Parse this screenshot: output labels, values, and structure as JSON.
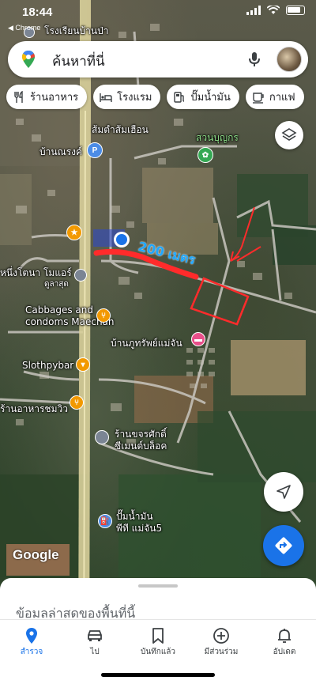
{
  "status_bar": {
    "time": "18:44",
    "back_label": "◀ Chrome"
  },
  "search": {
    "placeholder": "ค้นหาที่นี่"
  },
  "chips": [
    {
      "icon": "fork-knife-icon",
      "label": "ร้านอาหาร"
    },
    {
      "icon": "bed-icon",
      "label": "โรงแรม"
    },
    {
      "icon": "gas-pump-icon",
      "label": "ปั๊มน้ำมัน"
    },
    {
      "icon": "coffee-cup-icon",
      "label": "กาแฟ"
    }
  ],
  "map": {
    "annotation_text": "200 เมตร",
    "labels": {
      "school": "โรงเรียนบ้านป่า",
      "lomchaluem": "ส้มตำส้มเฮือน",
      "suanbunkon": "สวนบุญกร",
      "bannarong": "บ้านณรงค์",
      "nueng": "หนึ่งโตนา โมแอร์",
      "nueng_sub": "ดูลาสุด",
      "cabbages": "Cabbages and\ncondoms Maechan",
      "banphut": "บ้านภูทรัพย์แม่จัน",
      "slothpybar": "Slothpybar",
      "chomwiw": "ร้านอาหารชมวิว",
      "cement": "ร้านขจรศักดิ์\nซีเมนต์บล็อค",
      "gas": "ปั๊มน้ำมัน\nพีที แม่จัน5"
    },
    "pin_colors": {
      "blue": "#4b8ce6",
      "orange": "#f29900",
      "pink": "#e94f8a",
      "green": "#34a853",
      "gray": "#7b8594"
    },
    "annotation_color": "#ff2b2b"
  },
  "attribution": "Google",
  "sheet": {
    "title": "ข้อมูลล่าสุดของพื้นที่นี้"
  },
  "nav": [
    {
      "label": "สำรวจ",
      "icon": "location-pin-icon",
      "active": true
    },
    {
      "label": "ไป",
      "icon": "car-icon",
      "active": false
    },
    {
      "label": "บันทึกแล้ว",
      "icon": "bookmark-icon",
      "active": false
    },
    {
      "label": "มีส่วนร่วม",
      "icon": "plus-circle-icon",
      "active": false
    },
    {
      "label": "อัปเดต",
      "icon": "bell-icon",
      "active": false
    }
  ]
}
